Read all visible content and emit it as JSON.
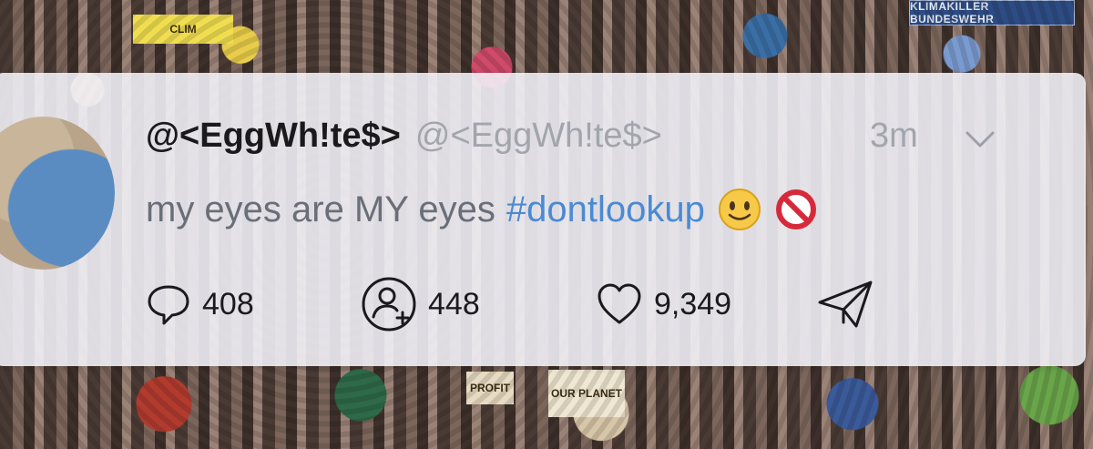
{
  "background": {
    "banner_text": "KLIMAKILLER BUNDESWEHR",
    "signs": [
      "CLIM",
      "PROFIT",
      "OUR PLANET"
    ]
  },
  "tweet": {
    "display_name": "@<EggWh!te$>",
    "handle": "@<EggWh!te$>",
    "time": "3m",
    "text": "my eyes are MY eyes",
    "hashtag": "#dontlookup",
    "emojis": [
      "smiling-face-icon",
      "prohibited-icon"
    ],
    "actions": {
      "replies": "408",
      "retweets": "448",
      "likes": "9,349"
    }
  },
  "colors": {
    "hashtag": "#4a8ad4",
    "card": "#f4f4fa"
  }
}
